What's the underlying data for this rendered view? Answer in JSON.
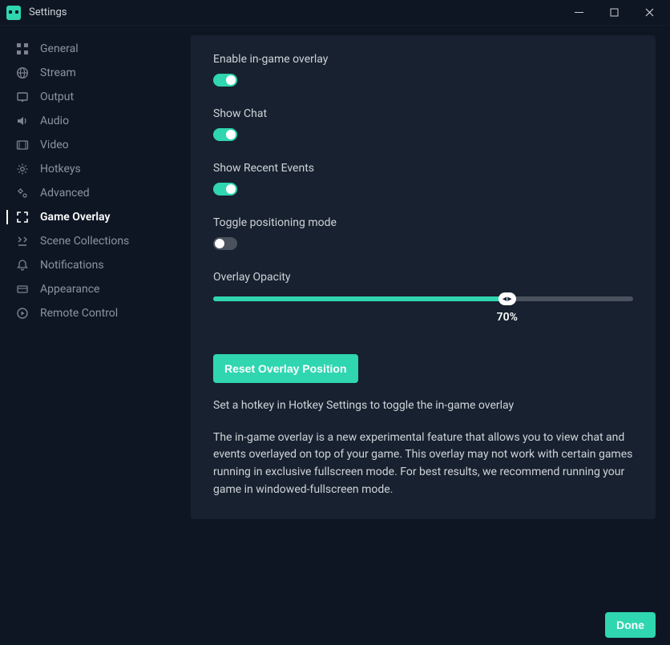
{
  "window": {
    "title": "Settings"
  },
  "sidebar": {
    "items": [
      {
        "label": "General"
      },
      {
        "label": "Stream"
      },
      {
        "label": "Output"
      },
      {
        "label": "Audio"
      },
      {
        "label": "Video"
      },
      {
        "label": "Hotkeys"
      },
      {
        "label": "Advanced"
      },
      {
        "label": "Game Overlay"
      },
      {
        "label": "Scene Collections"
      },
      {
        "label": "Notifications"
      },
      {
        "label": "Appearance"
      },
      {
        "label": "Remote Control"
      }
    ]
  },
  "settings": {
    "enable_overlay": {
      "label": "Enable in-game overlay",
      "value": true
    },
    "show_chat": {
      "label": "Show Chat",
      "value": true
    },
    "show_events": {
      "label": "Show Recent Events",
      "value": true
    },
    "toggle_positioning": {
      "label": "Toggle positioning mode",
      "value": false
    },
    "opacity": {
      "label": "Overlay Opacity",
      "value": 70,
      "display": "70%"
    },
    "reset_button": "Reset Overlay Position",
    "hint": "Set a hotkey in Hotkey Settings to toggle the in-game overlay",
    "description": "The in-game overlay is a new experimental feature that allows you to view chat and events overlayed on top of your game. This overlay may not work with certain games running in exclusive fullscreen mode. For best results, we recommend running your game in windowed-fullscreen mode."
  },
  "footer": {
    "done": "Done"
  }
}
